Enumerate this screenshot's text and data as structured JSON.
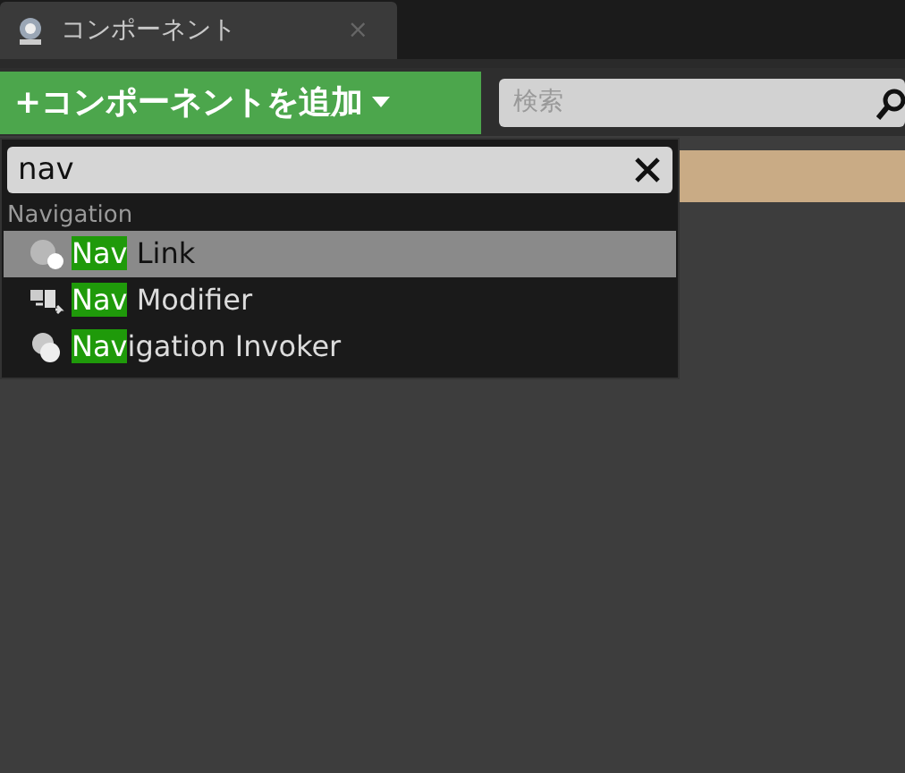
{
  "tab": {
    "title": "コンポーネント",
    "close": "×"
  },
  "add_button": {
    "label": "+コンポーネントを追加"
  },
  "search": {
    "placeholder": "検索"
  },
  "dropdown": {
    "query": "nav",
    "category": "Navigation",
    "items": [
      {
        "kind": "sphere",
        "match": "Nav",
        "rest": " Link",
        "selected": true
      },
      {
        "kind": "modifier",
        "match": "Nav",
        "rest": " Modifier",
        "selected": false
      },
      {
        "kind": "invoker",
        "match": "Nav",
        "rest": "igation Invoker",
        "selected": false
      }
    ]
  }
}
